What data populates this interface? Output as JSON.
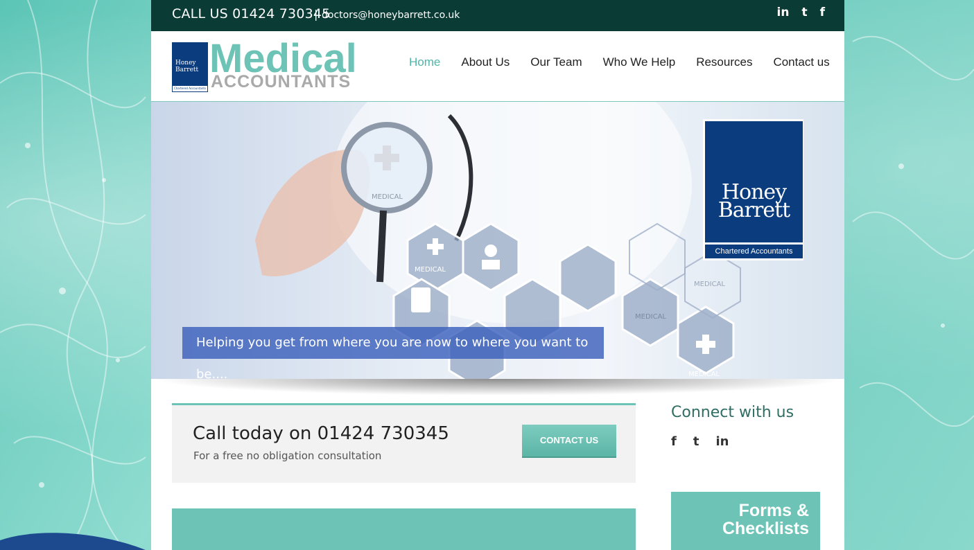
{
  "topbar": {
    "call": "CALL US 01424 730345",
    "separator": "|",
    "email": "doctors@honeybarrett.co.uk",
    "social": [
      "in",
      "t",
      "f"
    ]
  },
  "logo": {
    "box_name": "Honey Barrett",
    "box_sub": "Chartered Accountants",
    "medical": "Medical",
    "accountants": "ACCOUNTANTS"
  },
  "nav": {
    "items": [
      {
        "label": "Home"
      },
      {
        "label": "About Us"
      },
      {
        "label": "Our Team"
      },
      {
        "label": "Who We Help"
      },
      {
        "label": "Resources"
      },
      {
        "label": "Contact us"
      }
    ]
  },
  "hero": {
    "badge_name_1": "Honey",
    "badge_name_2": "Barrett",
    "badge_sub": "Chartered Accountants",
    "tagline": "Helping you get from where you are now to where you want to be....",
    "hex_labels": [
      "MEDICAL",
      "MEDICAL",
      "MEDICAL",
      "MEDICAL",
      "MEDICAL"
    ]
  },
  "callbox": {
    "heading": "Call today on 01424 730345",
    "sub": "For a free no obligation consultation",
    "button": "CONTACT US"
  },
  "sidebar": {
    "connect": "Connect with us",
    "social": [
      "f",
      "t",
      "in"
    ],
    "forms_line1": "Forms &",
    "forms_line2": "Checklists"
  },
  "colors": {
    "topbar": "#0b3b35",
    "accent": "#6cc3b6",
    "brand_blue": "#0b3c7d"
  }
}
